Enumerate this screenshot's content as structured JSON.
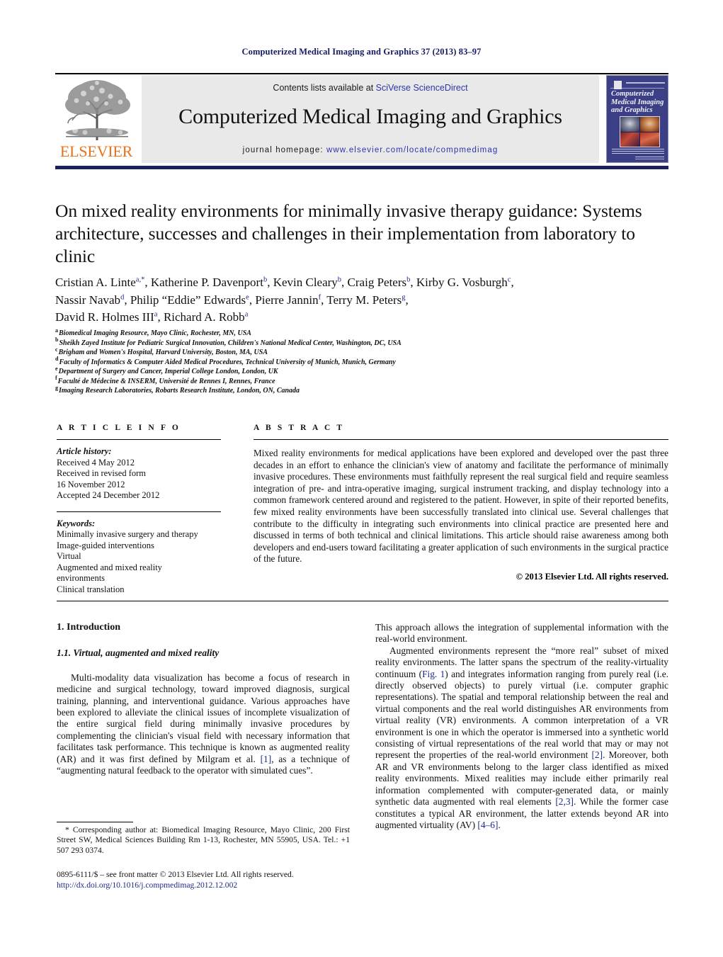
{
  "running_head": "Computerized Medical Imaging and Graphics 37 (2013) 83–97",
  "masthead": {
    "contents_prefix": "Contents lists available at ",
    "contents_link": "SciVerse ScienceDirect",
    "journal_title": "Computerized Medical Imaging and Graphics",
    "homepage_prefix": "journal homepage: ",
    "homepage_url": "www.elsevier.com/locate/compmedimag",
    "publisher_wordmark": "ELSEVIER",
    "cover_title": "Computerized Medical Imaging and Graphics",
    "accent_link_color": "#2b35a8",
    "publisher_color": "#E9711C",
    "rule_color": "#1b1f5e"
  },
  "article": {
    "title": "On mixed reality environments for minimally invasive therapy guidance: Systems architecture, successes and challenges in their implementation from laboratory to clinic",
    "authors_line1_a": "Cristian A. Linte",
    "authors_line1_a_sup": "a,*",
    "authors_line1_b": ", Katherine P. Davenport",
    "authors_line1_b_sup": "b",
    "authors_line1_c": ", Kevin Cleary",
    "authors_line1_c_sup": "b",
    "authors_line1_d": ", Craig Peters",
    "authors_line1_d_sup": "b",
    "authors_line1_e": ", Kirby G. Vosburgh",
    "authors_line1_e_sup": "c",
    "authors_line1_end": ",",
    "authors_line2_a": "Nassir Navab",
    "authors_line2_a_sup": "d",
    "authors_line2_b": ", Philip “Eddie” Edwards",
    "authors_line2_b_sup": "e",
    "authors_line2_c": ", Pierre Jannin",
    "authors_line2_c_sup": "f",
    "authors_line2_d": ", Terry M. Peters",
    "authors_line2_d_sup": "g",
    "authors_line2_end": ",",
    "authors_line3_a": "David R. Holmes III",
    "authors_line3_a_sup": "a",
    "authors_line3_b": ", Richard A. Robb",
    "authors_line3_b_sup": "a",
    "affiliations": [
      {
        "mark": "a",
        "text": "Biomedical Imaging Resource, Mayo Clinic, Rochester, MN, USA"
      },
      {
        "mark": "b",
        "text": "Sheikh Zayed Institute for Pediatric Surgical Innovation, Children's National Medical Center, Washington, DC, USA"
      },
      {
        "mark": "c",
        "text": "Brigham and Women's Hospital, Harvard University, Boston, MA, USA"
      },
      {
        "mark": "d",
        "text": "Faculty of Informatics & Computer Aided Medical Procedures, Technical University of Munich, Munich, Germany"
      },
      {
        "mark": "e",
        "text": "Department of Surgery and Cancer, Imperial College London, London, UK"
      },
      {
        "mark": "f",
        "text": "Faculté de Médecine & INSERM, Université de Rennes I, Rennes, France"
      },
      {
        "mark": "g",
        "text": "Imaging Research Laboratories, Robarts Research Institute, London, ON, Canada"
      }
    ]
  },
  "article_info": {
    "heading": "A R T I C L E   I N F O",
    "history_label": "Article history:",
    "history": [
      "Received 4 May 2012",
      "Received in revised form",
      "16 November 2012",
      "Accepted 24 December 2012"
    ],
    "keywords_label": "Keywords:",
    "keywords": [
      "Minimally invasive surgery and therapy",
      "Image-guided interventions",
      "Virtual",
      "Augmented and mixed reality",
      "environments",
      "Clinical translation"
    ]
  },
  "abstract": {
    "heading": "A B S T R A C T",
    "text": "Mixed reality environments for medical applications have been explored and developed over the past three decades in an effort to enhance the clinician's view of anatomy and facilitate the performance of minimally invasive procedures. These environments must faithfully represent the real surgical field and require seamless integration of pre- and intra-operative imaging, surgical instrument tracking, and display technology into a common framework centered around and registered to the patient. However, in spite of their reported benefits, few mixed reality environments have been successfully translated into clinical use. Several challenges that contribute to the difficulty in integrating such environments into clinical practice are presented here and discussed in terms of both technical and clinical limitations. This article should raise awareness among both developers and end-users toward facilitating a greater application of such environments in the surgical practice of the future.",
    "copyright": "© 2013 Elsevier Ltd. All rights reserved."
  },
  "body": {
    "section_heading": "1. Introduction",
    "subsection_heading": "1.1. Virtual, augmented and mixed reality",
    "left_para_1a": "Multi-modality data visualization has become a focus of research in medicine and surgical technology, toward improved diagnosis, surgical training, planning, and interventional guidance. Various approaches have been explored to alleviate the clinical issues of incomplete visualization of the entire surgical field during minimally invasive procedures by complementing the clinician's visual field with necessary information that facilitates task performance. This technique is known as augmented reality (AR) and it was first defined by Milgram et al. ",
    "left_ref_1": "[1]",
    "left_para_1b": ", as a technique of “augmenting natural feedback to the operator with simulated cues”.",
    "right_para_1": "This approach allows the integration of supplemental information with the real-world environment.",
    "right_para_2a": "Augmented environments represent the “more real” subset of mixed reality environments. The latter spans the spectrum of the reality-virtuality continuum (",
    "right_ref_fig1": "Fig. 1",
    "right_para_2b": ") and integrates information ranging from purely real (i.e. directly observed objects) to purely virtual (i.e. computer graphic representations). The spatial and temporal relationship between the real and virtual components and the real world distinguishes AR environments from virtual reality (VR) environments. A common interpretation of a VR environment is one in which the operator is immersed into a synthetic world consisting of virtual representations of the real world that may or may not represent the properties of the real-world environment ",
    "right_ref_2": "[2]",
    "right_para_2c": ". Moreover, both AR and VR environments belong to the larger class identified as mixed reality environments. Mixed realities may include either primarily real information complemented with computer-generated data, or mainly synthetic data augmented with real elements ",
    "right_ref_23": "[2,3]",
    "right_para_2d": ". While the former case constitutes a typical AR environment, the latter extends beyond AR into augmented virtuality (AV) ",
    "right_ref_46": "[4–6]",
    "right_para_2e": "."
  },
  "footer": {
    "corresponding_note": "* Corresponding author at: Biomedical Imaging Resource, Mayo Clinic, 200 First Street SW, Medical Sciences Building Rm 1-13, Rochester, MN 55905, USA. Tel.: +1 507 293 0374.",
    "issn_line": "0895-6111/$ – see front matter © 2013 Elsevier Ltd. All rights reserved.",
    "doi": "http://dx.doi.org/10.1016/j.compmedimag.2012.12.002"
  }
}
